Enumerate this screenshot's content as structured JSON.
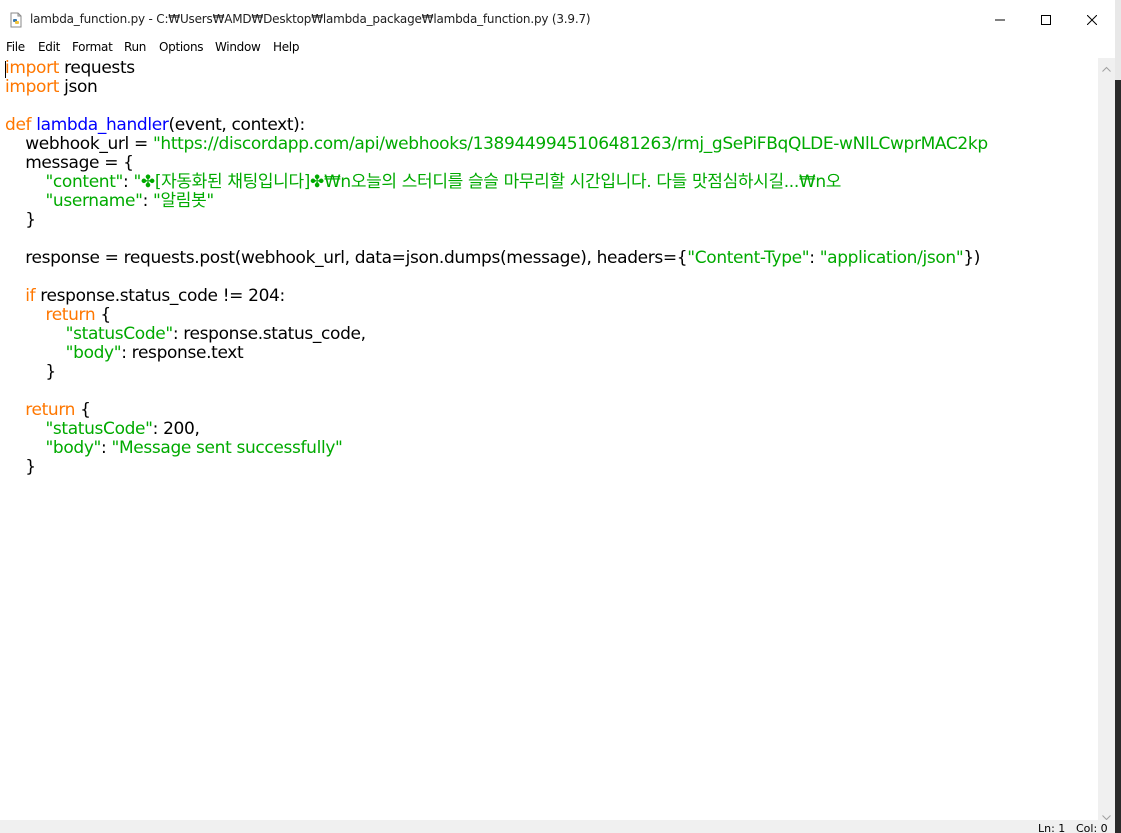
{
  "window": {
    "title": "lambda_function.py - C:₩Users₩AMD₩Desktop₩lambda_package₩lambda_function.py (3.9.7)",
    "icon": "python-file-icon",
    "controls": {
      "minimize": "minimize-icon",
      "maximize": "maximize-icon",
      "close": "close-icon"
    }
  },
  "menu": [
    "File",
    "Edit",
    "Format",
    "Run",
    "Options",
    "Window",
    "Help"
  ],
  "code": {
    "l1_kw": "import",
    "l1_rest": " requests",
    "l2_kw": "import",
    "l2_rest": " json",
    "l4_kw": "def",
    "l4_name": "lambda_handler",
    "l4_rest": "(event, context):",
    "l5_pre": "    webhook_url = ",
    "l5_str": "\"https://discordapp.com/api/webhooks/1389449945106481263/rmj_gSePiFBqQLDE-wNlLCwprMAC2kp",
    "l6": "    message = {",
    "l7_pre": "        ",
    "l7_key": "\"content\"",
    "l7_colon": ": ",
    "l7_val": "\"✤[자동화된 채팅입니다]✤₩n오늘의 스터디를 슬슬 마무리할 시간입니다. 다들 맛점심하시길...₩n오",
    "l8_pre": "        ",
    "l8_key": "\"username\"",
    "l8_colon": ": ",
    "l8_val": "\"알림봇\"",
    "l9": "    }",
    "l11_pre": "    response = requests.post(webhook_url, data=json.dumps(message), headers={",
    "l11_k": "\"Content-Type\"",
    "l11_mid": ": ",
    "l11_v": "\"application/json\"",
    "l11_end": "})",
    "l13_pre": "    ",
    "l13_kw": "if",
    "l13_rest": " response.status_code != 204:",
    "l14_pre": "        ",
    "l14_kw": "return",
    "l14_rest": " {",
    "l15_pre": "            ",
    "l15_key": "\"statusCode\"",
    "l15_rest": ": response.status_code,",
    "l16_pre": "            ",
    "l16_key": "\"body\"",
    "l16_rest": ": response.text",
    "l17": "        }",
    "l19_pre": "    ",
    "l19_kw": "return",
    "l19_rest": " {",
    "l20_pre": "        ",
    "l20_key": "\"statusCode\"",
    "l20_rest": ": 200,",
    "l21_pre": "        ",
    "l21_key": "\"body\"",
    "l21_colon": ": ",
    "l21_val": "\"Message sent successfully\"",
    "l22": "    }"
  },
  "status": {
    "ln": "Ln: 1",
    "col": "Col: 0"
  },
  "colors": {
    "keyword": "#ff7700",
    "definition": "#0000ff",
    "string": "#00aa00"
  }
}
